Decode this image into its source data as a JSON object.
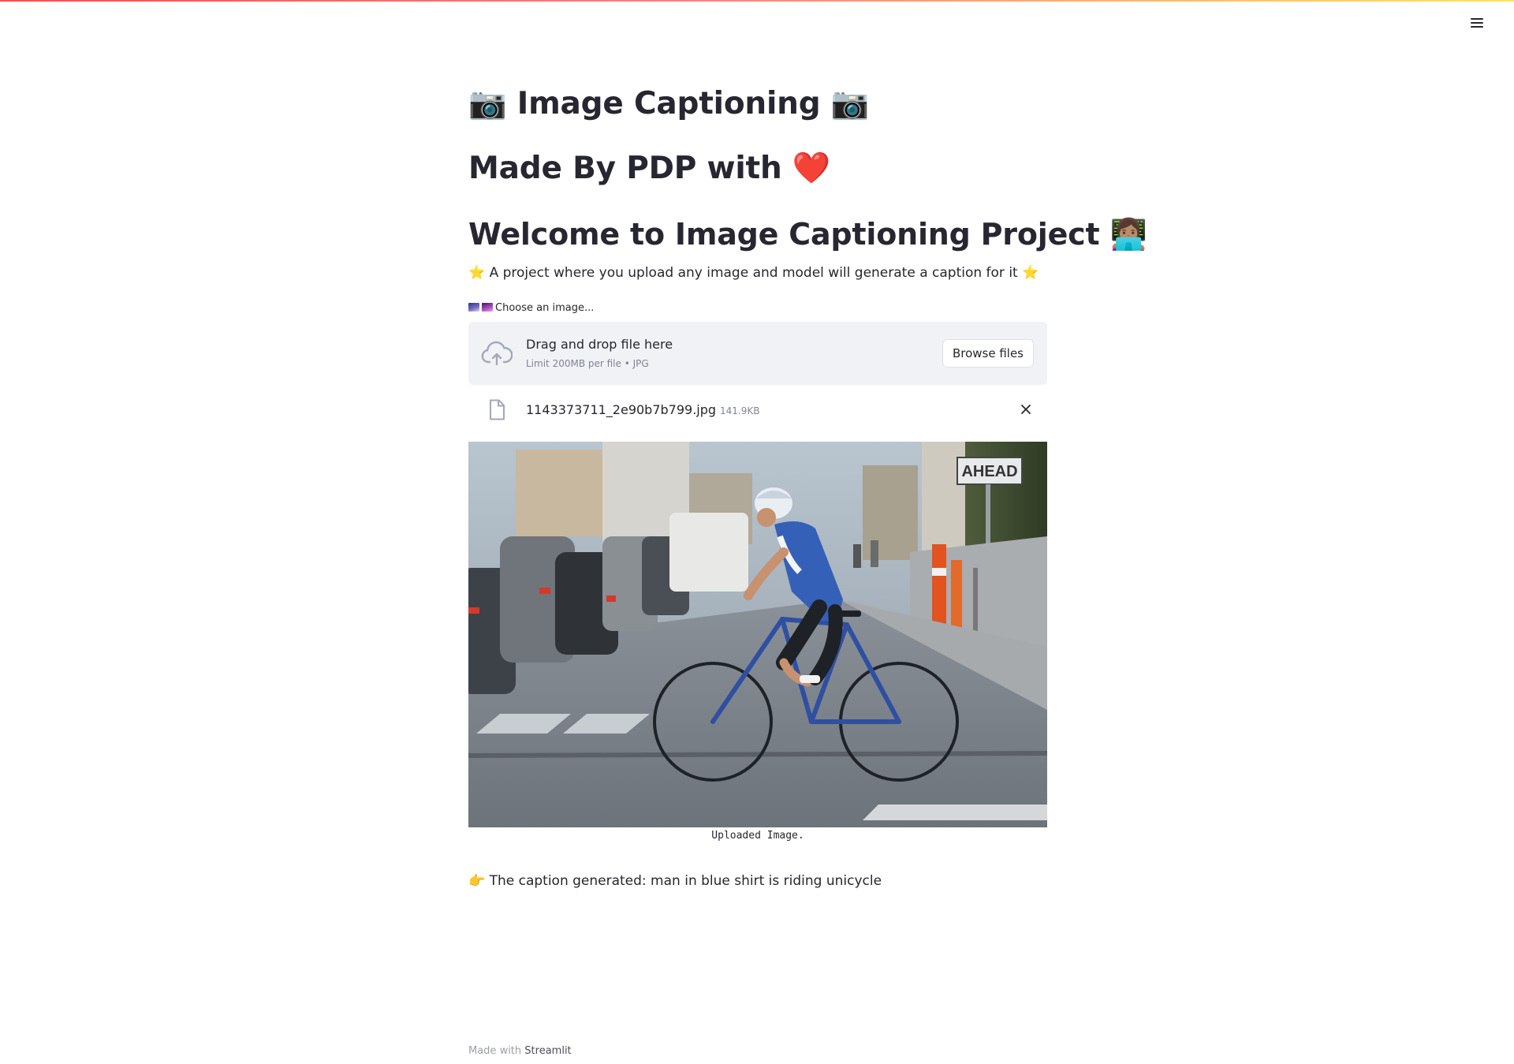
{
  "header": {
    "menu_icon": "hamburger-menu-icon"
  },
  "main": {
    "title": "Image Captioning",
    "title_emoji": "📷",
    "made_by": "Made By PDP with",
    "made_by_emoji": "❤️",
    "welcome": "Welcome to Image Captioning Project",
    "welcome_emoji": "👩🏽‍💻",
    "subtitle": "A project where you upload any image and model will generate a caption for it",
    "subtitle_emoji": "⭐"
  },
  "uploader": {
    "label": "Choose an image...",
    "drag_text": "Drag and drop file here",
    "limit_text": "Limit 200MB per file • JPG",
    "browse_label": "Browse files",
    "file": {
      "name": "1143373711_2e90b7b799.jpg",
      "size": "141.9KB"
    }
  },
  "image": {
    "caption": "Uploaded Image.",
    "sign_text": "AHEAD"
  },
  "result": {
    "emoji": "👉",
    "text": "The caption generated: man in blue shirt is riding unicycle"
  },
  "footer": {
    "prefix": "Made with",
    "brand": "Streamlit"
  },
  "colors": {
    "text": "#262730",
    "muted": "#808495",
    "dropzone_bg": "#f0f2f6",
    "accent_red": "#ff4b4b",
    "accent_yellow": "#ffe45c"
  }
}
